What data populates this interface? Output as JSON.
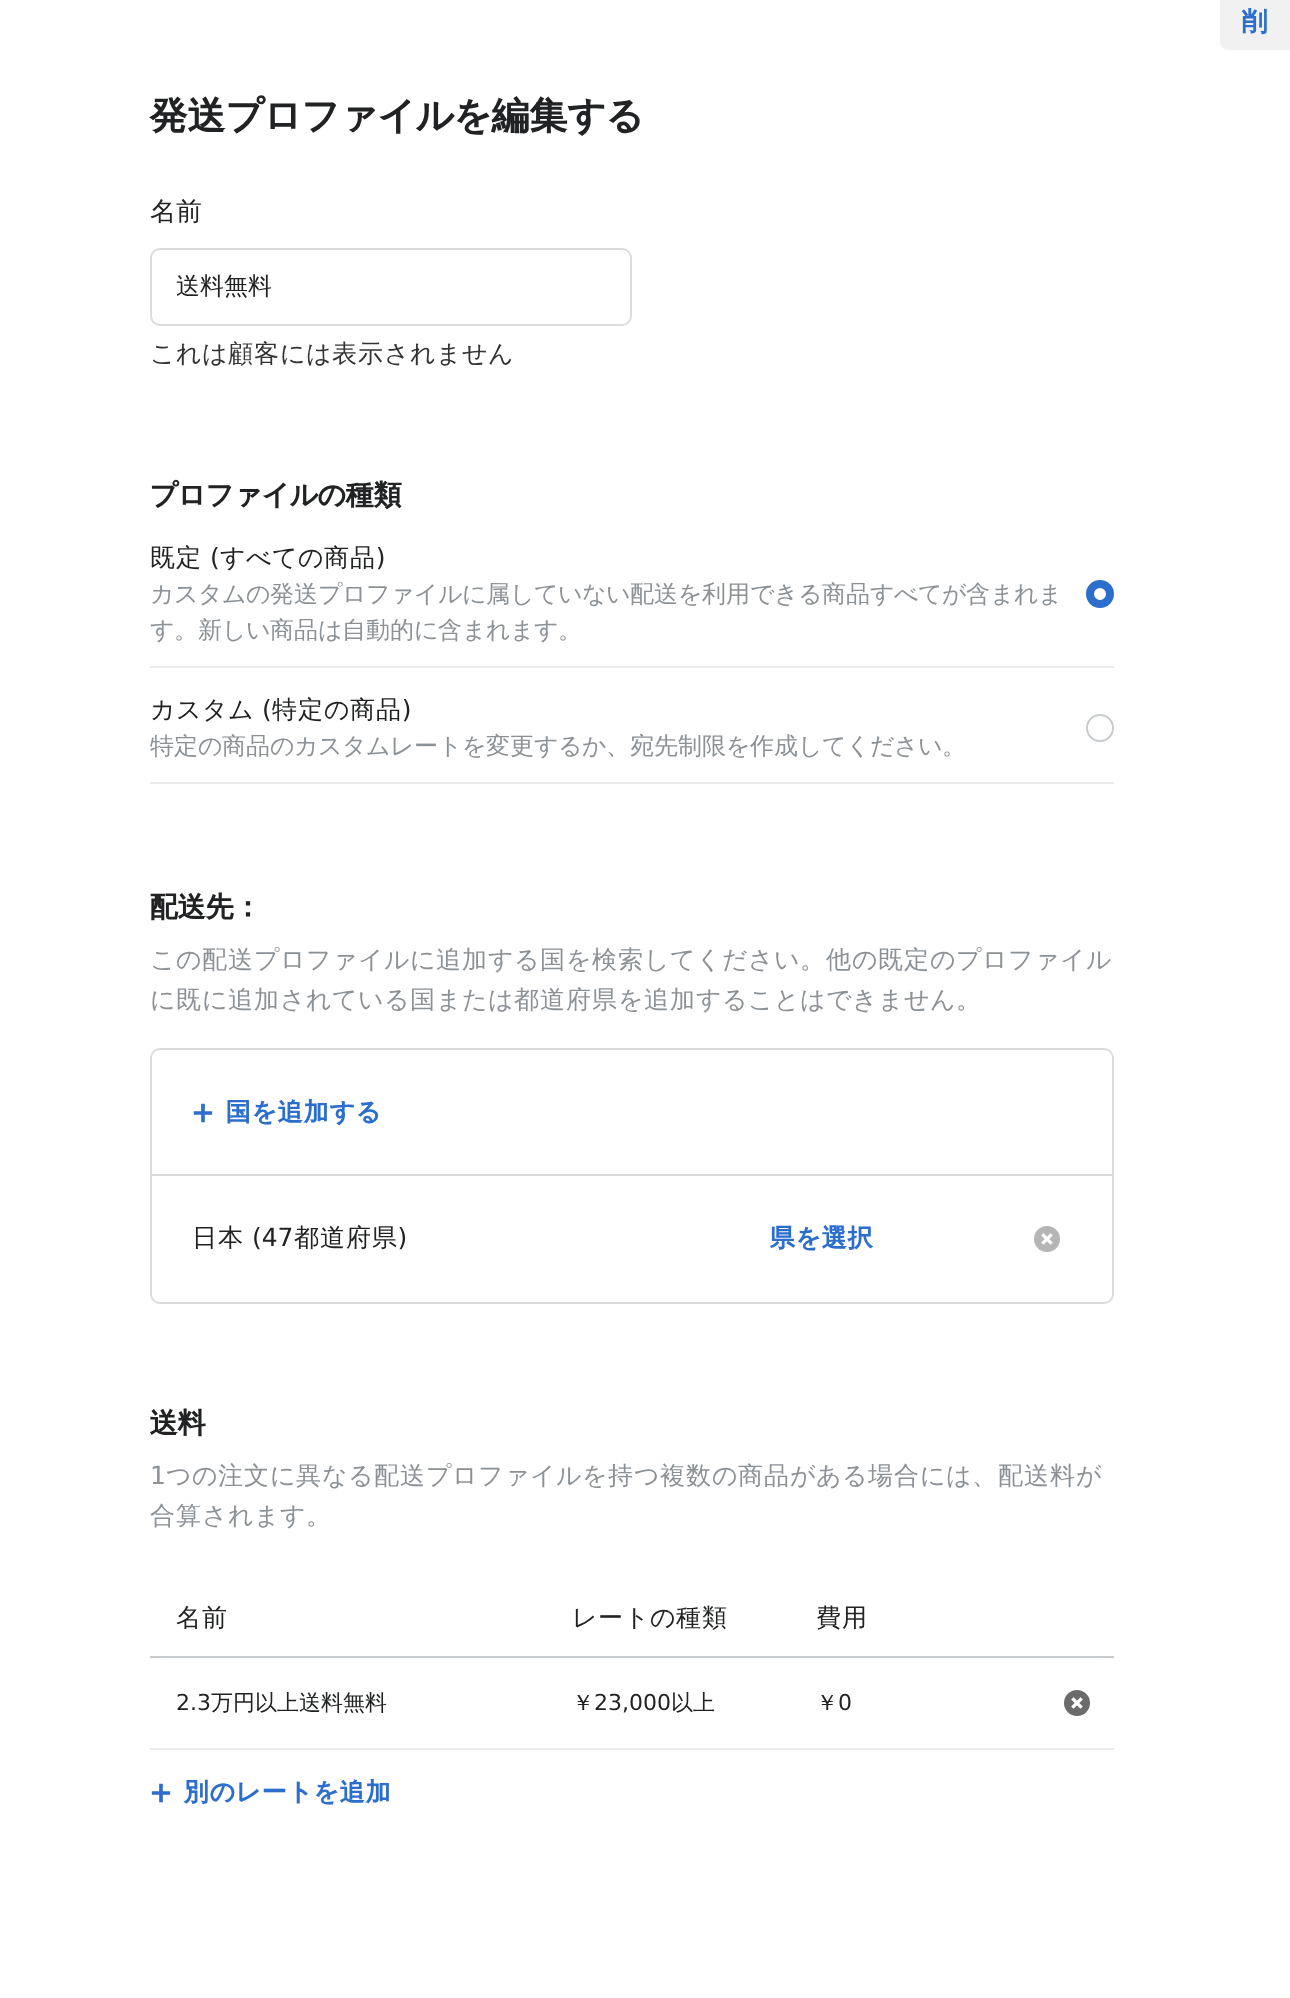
{
  "top_button": {
    "label": "削"
  },
  "title": "発送プロファイルを編集する",
  "name_field": {
    "label": "名前",
    "value": "送料無料",
    "help": "これは顧客には表示されません"
  },
  "profile_type": {
    "heading": "プロファイルの種類",
    "options": [
      {
        "title": "既定 (すべての商品)",
        "description": "カスタムの発送プロファイルに属していない配送を利用できる商品すべてが含まれます。新しい商品は自動的に含まれます。",
        "selected": true
      },
      {
        "title": "カスタム (特定の商品)",
        "description": "特定の商品のカスタムレートを変更するか、宛先制限を作成してください。",
        "selected": false
      }
    ]
  },
  "destinations": {
    "heading": "配送先：",
    "description": "この配送プロファイルに追加する国を検索してください。他の既定のプロファイルに既に追加されている国または都道府県を追加することはできません。",
    "add_link": "国を追加する",
    "countries": [
      {
        "name": "日本 (47都道府県)",
        "action": "県を選択"
      }
    ]
  },
  "rates": {
    "heading": "送料",
    "description": "1つの注文に異なる配送プロファイルを持つ複数の商品がある場合には、配送料が合算されます。",
    "columns": [
      "名前",
      "レートの種類",
      "費用"
    ],
    "rows": [
      {
        "cells": [
          "2.3万円以上送料無料",
          "￥23,000以上",
          "￥0"
        ]
      }
    ],
    "add_link": "別のレートを追加"
  }
}
